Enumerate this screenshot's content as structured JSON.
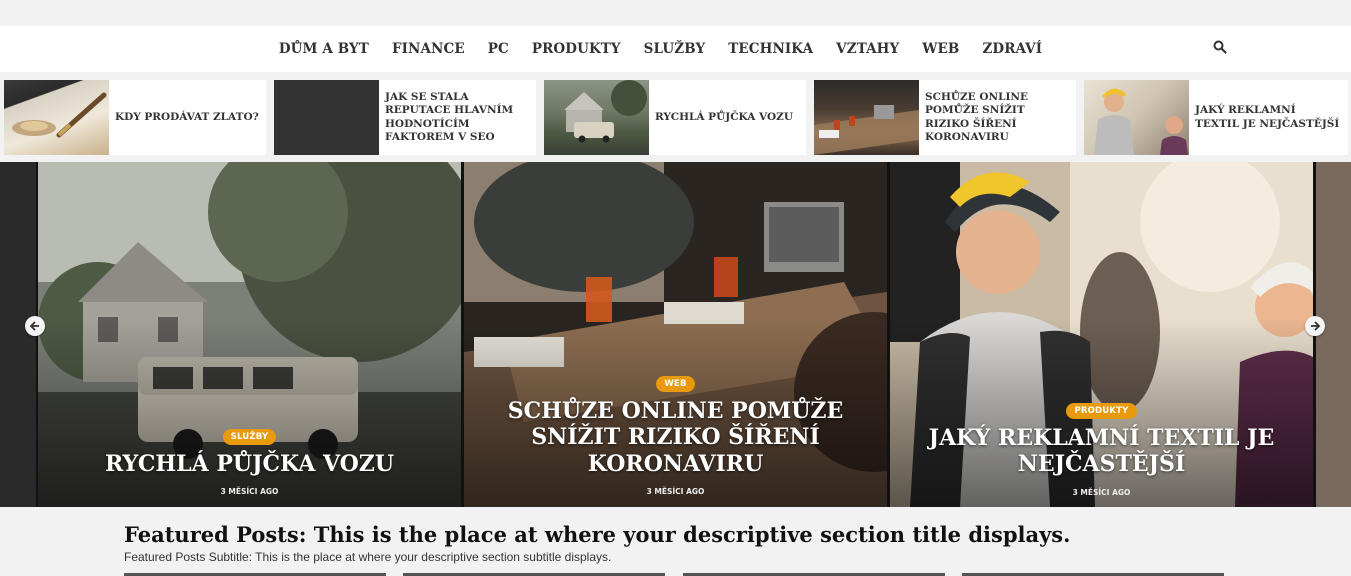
{
  "nav": {
    "items": [
      "DŮM A BYT",
      "FINANCE",
      "PC",
      "PRODUKTY",
      "SLUŽBY",
      "TECHNIKA",
      "VZTAHY",
      "WEB",
      "ZDRAVÍ"
    ],
    "search_icon": "search-icon"
  },
  "ticker": [
    {
      "title": "KDY PRODÁVAT ZLATO?"
    },
    {
      "title": "JAK SE STALA REPUTACE HLAVNÍM HODNOTÍCÍM FAKTOREM V SEO"
    },
    {
      "title": "RYCHLÁ PŮJČKA VOZU"
    },
    {
      "title": "SCHŮZE ONLINE POMŮŽE SNÍŽIT RIZIKO ŠÍŘENÍ KORONAVIRU"
    },
    {
      "title": "JAKÝ REKLAMNÍ TEXTIL JE NEJČASTĚJŠÍ"
    }
  ],
  "slider": {
    "slides": [
      {
        "category": "SLUŽBY",
        "title": "RYCHLÁ PŮJČKA VOZU",
        "date": "3 MĚSÍCI AGO"
      },
      {
        "category": "WEB",
        "title": "SCHŮZE ONLINE POMŮŽE SNÍŽIT RIZIKO ŠÍŘENÍ KORONAVIRU",
        "date": "3 MĚSÍCI AGO"
      },
      {
        "category": "PRODUKTY",
        "title": "JAKÝ REKLAMNÍ TEXTIL JE NEJČASTĚJŠÍ",
        "date": "3 MĚSÍCI AGO"
      }
    ],
    "prev_icon": "arrow-left-icon",
    "next_icon": "arrow-right-icon"
  },
  "featured": {
    "title": "Featured Posts: This is the place at where your descriptive section title displays.",
    "subtitle": "Featured Posts Subtitle: This is the place at where your descriptive section subtitle displays."
  },
  "colors": {
    "badge": "#e89a0c",
    "nav_bg": "#ffffff",
    "page_bg": "#f2f2f2"
  }
}
